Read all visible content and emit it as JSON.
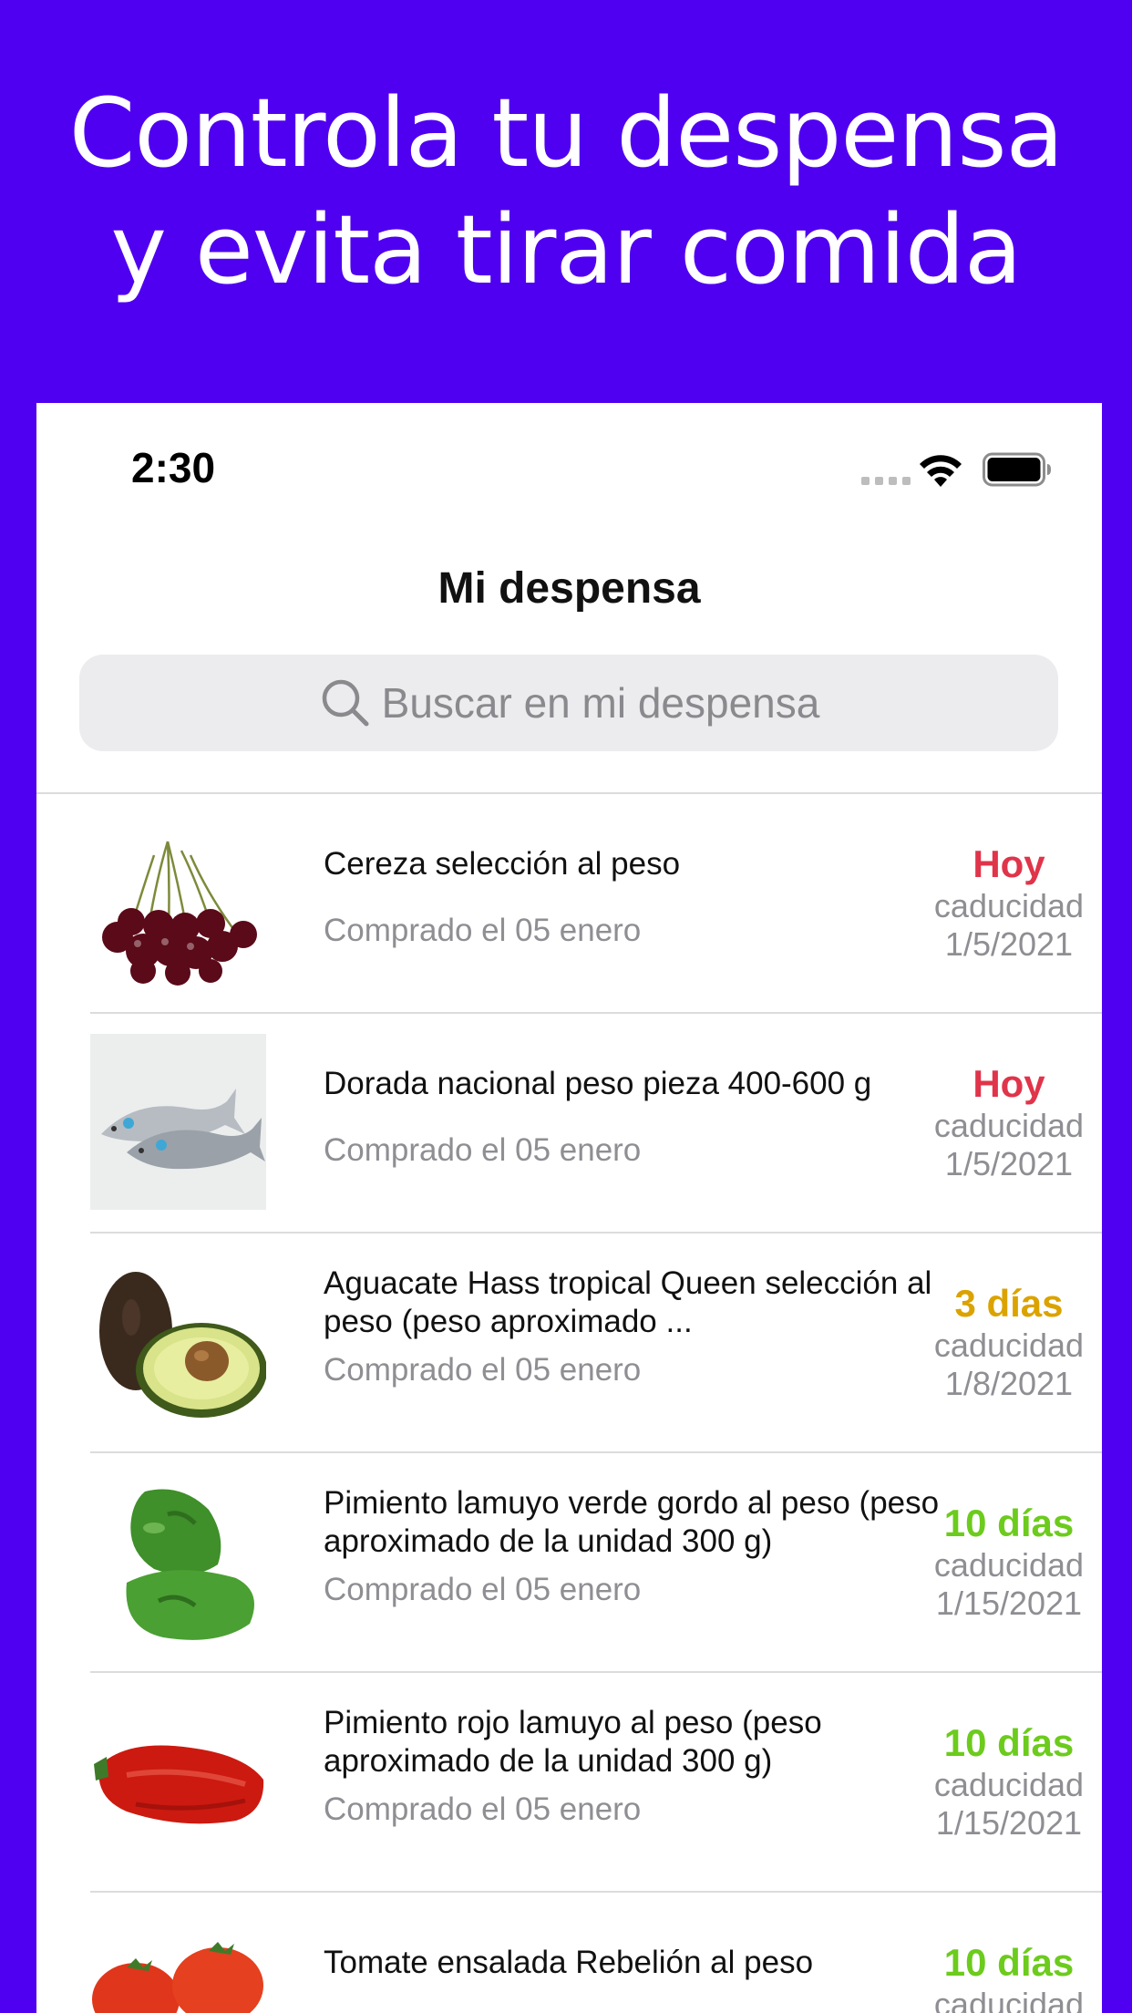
{
  "promo": {
    "line1": "Controla tu despensa",
    "line2": "y evita tirar comida",
    "background_color": "#5000F0"
  },
  "status_bar": {
    "time": "2:30"
  },
  "nav": {
    "title": "Mi despensa"
  },
  "search": {
    "placeholder": "Buscar en mi despensa"
  },
  "items": [
    {
      "name": "Cereza selección al peso",
      "purchased": "Comprado el 05 enero",
      "expiry_value": "Hoy",
      "expiry_label": "caducidad",
      "expiry_date": "1/5/2021",
      "expiry_color": "#E0344A",
      "image_icon": "cherries-icon"
    },
    {
      "name": "Dorada nacional peso pieza 400-600 g",
      "purchased": "Comprado el 05 enero",
      "expiry_value": "Hoy",
      "expiry_label": "caducidad",
      "expiry_date": "1/5/2021",
      "expiry_color": "#E0344A",
      "image_icon": "fish-icon"
    },
    {
      "name": "Aguacate Hass tropical Queen selección al peso (peso aproximado ...",
      "purchased": "Comprado el 05 enero",
      "expiry_value": "3 días",
      "expiry_label": "caducidad",
      "expiry_date": "1/8/2021",
      "expiry_color": "#DBA300",
      "image_icon": "avocado-icon"
    },
    {
      "name": "Pimiento lamuyo verde gordo al peso (peso aproximado de la unidad 300 g)",
      "purchased": "Comprado el 05 enero",
      "expiry_value": "10 días",
      "expiry_label": "caducidad",
      "expiry_date": "1/15/2021",
      "expiry_color": "#6CCB1C",
      "image_icon": "green-pepper-icon"
    },
    {
      "name": "Pimiento rojo lamuyo al peso (peso aproximado de la unidad 300 g)",
      "purchased": "Comprado el 05 enero",
      "expiry_value": "10 días",
      "expiry_label": "caducidad",
      "expiry_date": "1/15/2021",
      "expiry_color": "#6CCB1C",
      "image_icon": "red-pepper-icon"
    },
    {
      "name": "Tomate ensalada Rebelión al peso",
      "purchased": "",
      "expiry_value": "10 días",
      "expiry_label": "caducidad",
      "expiry_date": "",
      "expiry_color": "#6CCB1C",
      "image_icon": "tomato-icon"
    }
  ]
}
